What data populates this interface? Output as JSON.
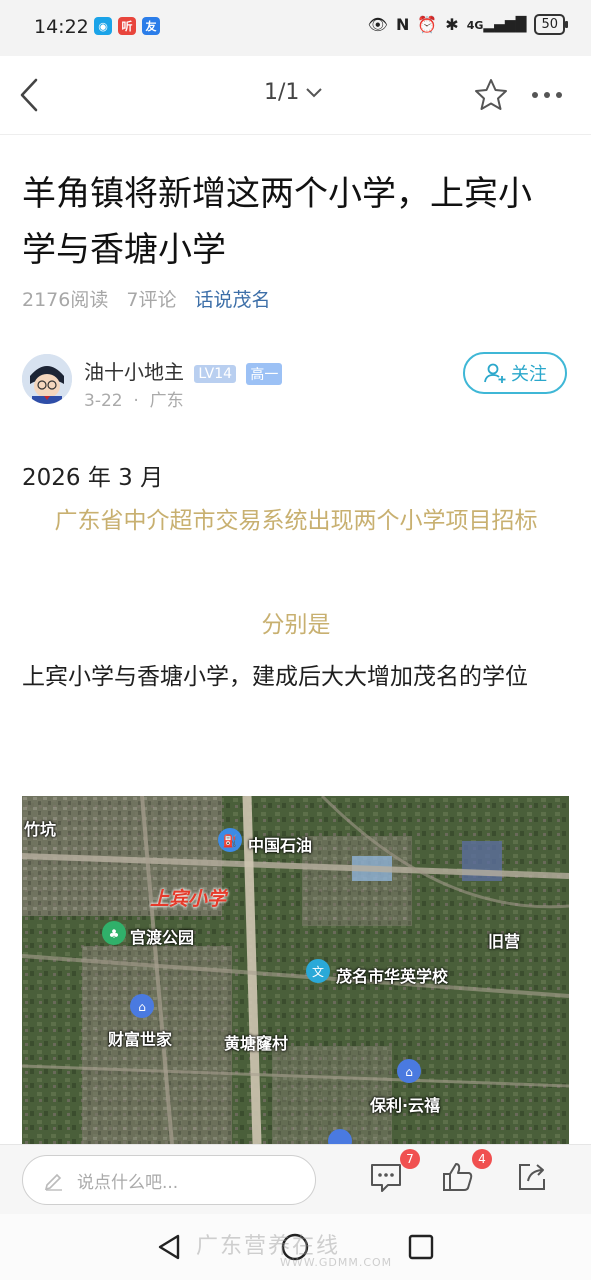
{
  "status_bar": {
    "time": "14:22",
    "network": "4G",
    "battery": "50"
  },
  "nav": {
    "page_indicator": "1/1"
  },
  "article": {
    "title": "羊角镇将新增这两个小学，上宾小学与香塘小学",
    "reads": "2176阅读",
    "comments": "7评论",
    "topic": "话说茂名",
    "author": {
      "name": "油十小地主",
      "level": "LV14",
      "grade": "高一",
      "date": "3-22",
      "sep": "·",
      "location": "广东"
    },
    "follow_label": "关注",
    "paragraphs": {
      "date_line": "2026 年 3 月",
      "highlight1": "广东省中介超市交易系统出现两个小学项目招标",
      "highlight2": "分别是",
      "body": "上宾小学与香塘小学，建成后大大增加茂名的学位"
    },
    "map_labels": {
      "zhukeng": "竹坑",
      "sinopec": "中国石油",
      "shangbin": "上宾小学",
      "guandu": "官渡公园",
      "jiuying": "旧营",
      "huaying": "茂名市华英学校",
      "caifu": "财富世家",
      "huangtang": "黄塘窿村",
      "poly": "保利·云禧"
    }
  },
  "bottom_bar": {
    "comment_placeholder": "说点什么吧...",
    "comment_count": "7",
    "like_count": "4"
  },
  "watermark": {
    "text": "广东营养在线",
    "url": "WWW.GDMM.COM"
  }
}
